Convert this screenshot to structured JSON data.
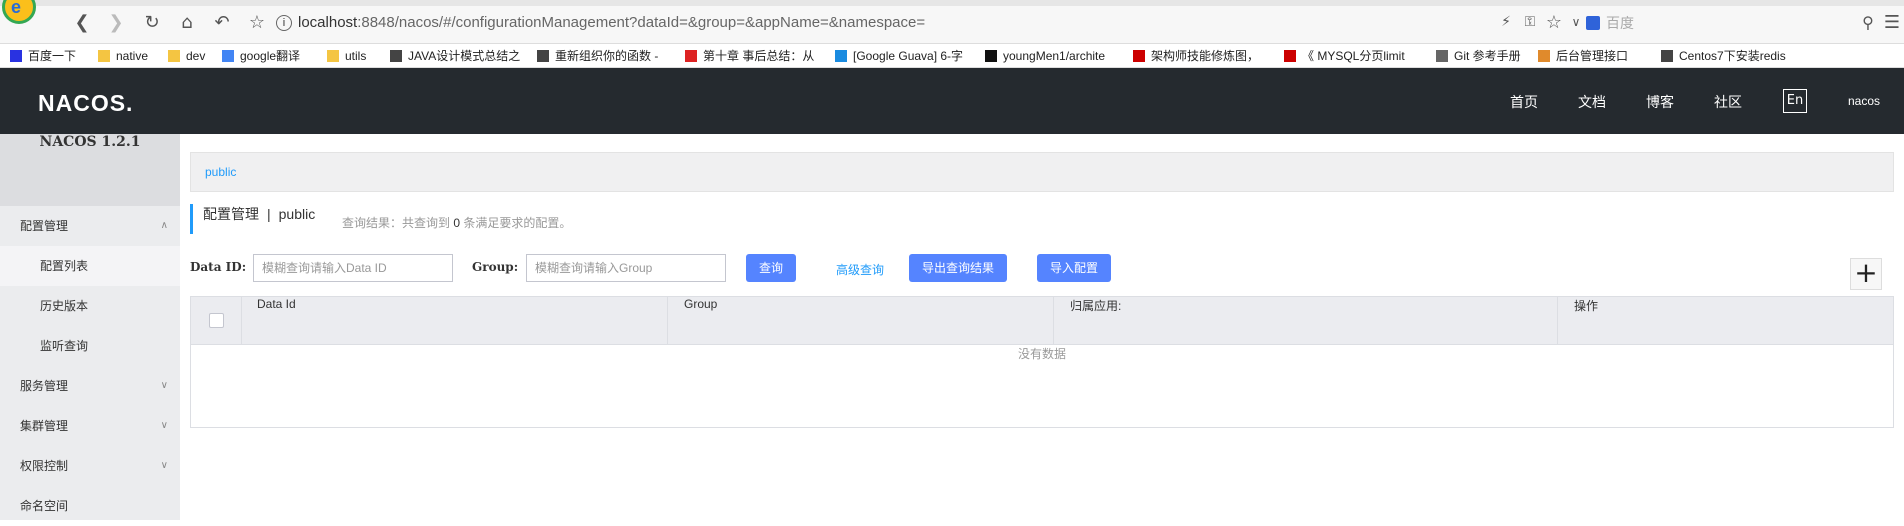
{
  "browser": {
    "url_host": "localhost",
    "url_rest": ":8848/nacos/#/configurationManagement?dataId=&group=&appName=&namespace=",
    "search_placeholder": "百度"
  },
  "bookmarks": [
    {
      "label": "百度一下",
      "icon": "paw-icon",
      "color": "#2932e1"
    },
    {
      "label": "native",
      "icon": "folder-icon",
      "color": "#f4c542"
    },
    {
      "label": "dev",
      "icon": "folder-icon",
      "color": "#f4c542"
    },
    {
      "label": "google翻译",
      "icon": "translate-icon",
      "color": "#4285f4"
    },
    {
      "label": "utils",
      "icon": "folder-icon",
      "color": "#f4c542"
    },
    {
      "label": "JAVA设计模式总结之",
      "icon": "bookmark-icon",
      "color": "#444"
    },
    {
      "label": "重新组织你的函数 - ",
      "icon": "pen-icon",
      "color": "#444"
    },
    {
      "label": "第十章 事后总结：从",
      "icon": "flag-icon",
      "color": "#d22"
    },
    {
      "label": "[Google Guava] 6-字",
      "icon": "gear-icon",
      "color": "#1a8be0"
    },
    {
      "label": "youngMen1/archite",
      "icon": "github-icon",
      "color": "#111"
    },
    {
      "label": "架构师技能修炼图，",
      "icon": "c-icon",
      "color": "#c00"
    },
    {
      "label": "《 MYSQL分页limit",
      "icon": "c-icon",
      "color": "#c00"
    },
    {
      "label": "Git 参考手册",
      "icon": "doc-icon",
      "color": "#666"
    },
    {
      "label": "后台管理接口",
      "icon": "circle-icon",
      "color": "#e08a2c"
    },
    {
      "label": "Centos7下安装redis",
      "icon": "bookmark-icon",
      "color": "#444"
    }
  ],
  "topnav": {
    "brand": "NACOS.",
    "links": [
      "首页",
      "文档",
      "博客",
      "社区"
    ],
    "lang": "En",
    "user": "nacos"
  },
  "sidebar": {
    "title": "NACOS 1.2.1",
    "items": [
      {
        "label": "配置管理",
        "type": "group",
        "expanded": true
      },
      {
        "label": "配置列表",
        "type": "sub",
        "active": true
      },
      {
        "label": "历史版本",
        "type": "sub"
      },
      {
        "label": "监听查询",
        "type": "sub"
      },
      {
        "label": "服务管理",
        "type": "group"
      },
      {
        "label": "集群管理",
        "type": "group"
      },
      {
        "label": "权限控制",
        "type": "group"
      },
      {
        "label": "命名空间",
        "type": "item"
      }
    ]
  },
  "main": {
    "namespace": "public",
    "crumb_title": "配置管理",
    "crumb_sep": "|",
    "crumb_ns": "public",
    "result_prefix": "查询结果：共查询到",
    "result_count": "0",
    "result_suffix": "条满足要求的配置。",
    "dataid_label": "Data ID:",
    "dataid_placeholder": "模糊查询请输入Data ID",
    "group_label": "Group:",
    "group_placeholder": "模糊查询请输入Group",
    "query_btn": "查询",
    "advanced_link": "高级查询",
    "export_btn": "导出查询结果",
    "import_btn": "导入配置",
    "add_icon": "+",
    "columns": [
      "Data Id",
      "Group",
      "归属应用:",
      "操作"
    ],
    "empty_text": "没有数据"
  }
}
